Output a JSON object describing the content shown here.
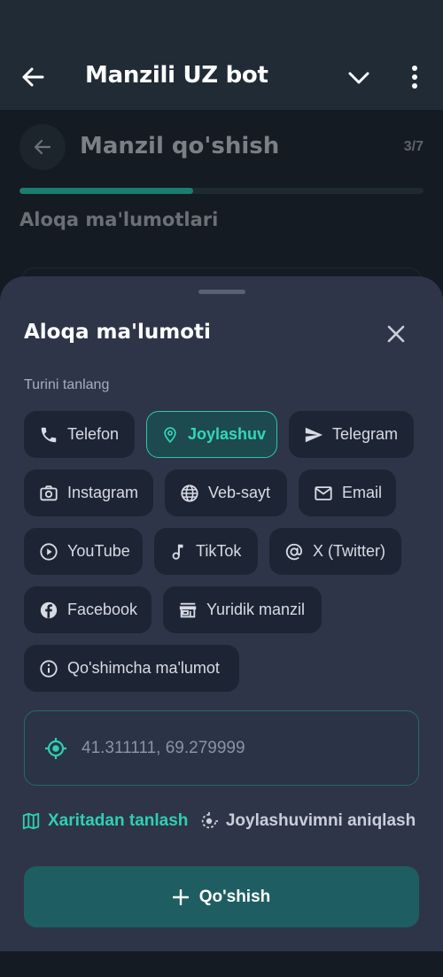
{
  "header": {
    "title": "Manzili UZ bot",
    "back_icon": "arrow-left-icon",
    "collapse_icon": "chevron-down-icon",
    "more_icon": "more-vertical-icon"
  },
  "webapp": {
    "title": "Manzil qo'shish",
    "step": "3/7",
    "progress": 0.43,
    "section_title": "Aloqa ma'lumotlari"
  },
  "sheet": {
    "title": "Aloqa ma'lumoti",
    "type_label": "Turini tanlang",
    "types": [
      {
        "label": "Telefon",
        "icon": "phone-icon"
      },
      {
        "label": "Joylashuv",
        "icon": "location-pin-icon",
        "selected": true
      },
      {
        "label": "Telegram",
        "icon": "send-icon"
      },
      {
        "label": "Instagram",
        "icon": "camera-icon"
      },
      {
        "label": "Veb-sayt",
        "icon": "globe-icon"
      },
      {
        "label": "Email",
        "icon": "mail-icon"
      },
      {
        "label": "YouTube",
        "icon": "play-circle-icon"
      },
      {
        "label": "TikTok",
        "icon": "music-note-icon"
      },
      {
        "label": "X (Twitter)",
        "icon": "at-sign-icon"
      },
      {
        "label": "Facebook",
        "icon": "facebook-icon"
      },
      {
        "label": "Yuridik manzil",
        "icon": "storefront-icon"
      },
      {
        "label": "Qo'shimcha ma'lumot",
        "icon": "info-icon"
      }
    ],
    "coordinates_value": "41.311111, 69.279999",
    "pick_on_map": "Xaritadan tanlash",
    "detect_location": "Joylashuvimni aniqlash",
    "add_button": "Qo'shish"
  },
  "colors": {
    "accent": "#2fcfb4",
    "sheet_bg": "#2e3548",
    "chip_bg": "#1d2433",
    "add_button_bg": "#1e5e62"
  }
}
